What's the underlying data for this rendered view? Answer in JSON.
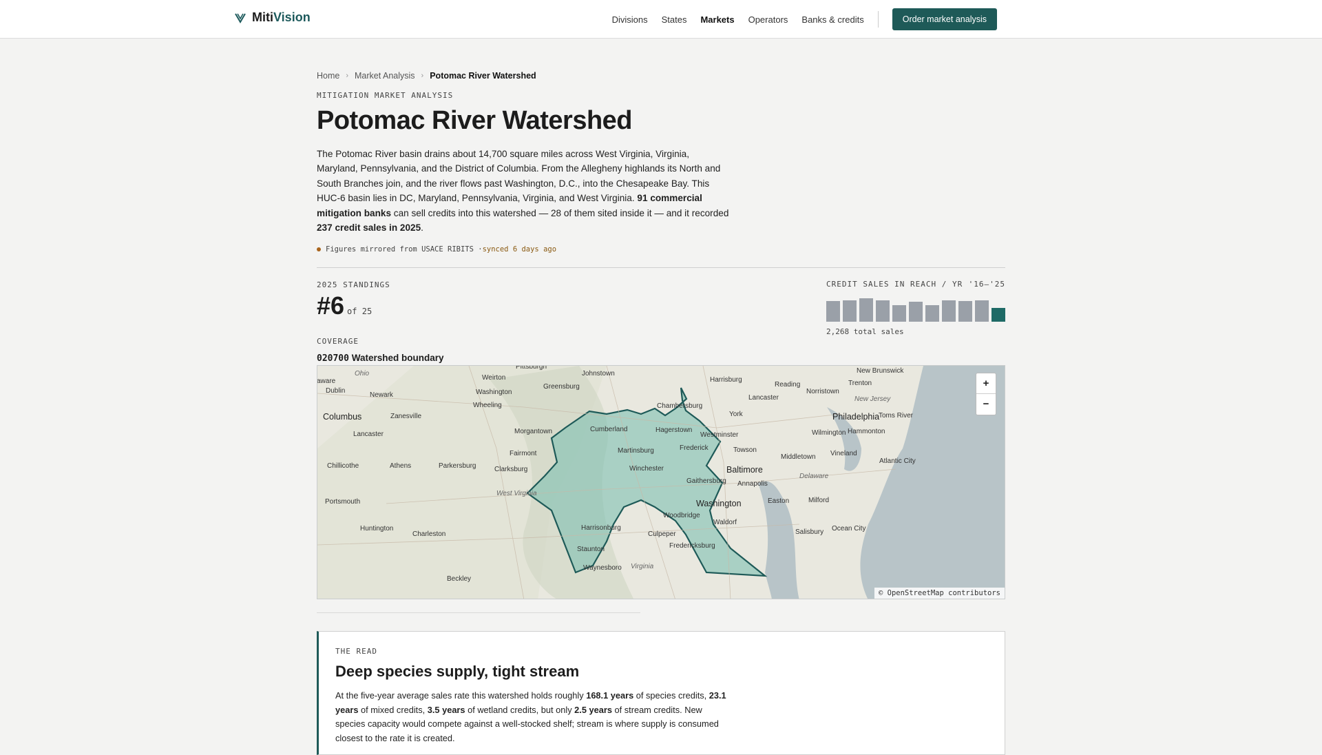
{
  "brand": {
    "name_a": "Miti",
    "name_b": "Vision"
  },
  "nav": {
    "items": [
      "Divisions",
      "States",
      "Markets",
      "Operators",
      "Banks & credits"
    ],
    "active": "Markets",
    "cta": "Order market analysis"
  },
  "breadcrumb": {
    "home": "Home",
    "section": "Market Analysis",
    "current": "Potomac River Watershed"
  },
  "header": {
    "eyebrow": "MITIGATION MARKET ANALYSIS",
    "title": "Potomac River Watershed",
    "desc_1": "The Potomac River basin drains about 14,700 square miles across West Virginia, Virginia, Maryland, Pennsylvania, and the District of Columbia. From the Allegheny highlands its North and South Branches join, and the river flows past Washington, D.C., into the Chesapeake Bay. This HUC-6 basin lies in DC, Maryland, Pennsylvania, Virginia, and West Virginia. ",
    "desc_b1": "91 commercial mitigation banks",
    "desc_2": " can sell credits into this watershed — 28 of them sited inside it — and it recorded ",
    "desc_b2": "237 credit sales in 2025",
    "desc_3": ".",
    "sync_text": "Figures mirrored from USACE RIBITS · ",
    "sync_ago": "synced 6 days ago"
  },
  "standings": {
    "label": "2025 STANDINGS",
    "rank": "#6",
    "of": "of 25"
  },
  "sparkline": {
    "label": "CREDIT SALES IN REACH / YR",
    "range": "'16–'25",
    "values": [
      0.75,
      0.78,
      0.85,
      0.78,
      0.6,
      0.72,
      0.6,
      0.78,
      0.74,
      0.78,
      0.5
    ],
    "total": "2,268 total sales"
  },
  "coverage": {
    "label": "COVERAGE",
    "code": "020700",
    "name": " Watershed boundary"
  },
  "map": {
    "zoom_in": "+",
    "zoom_out": "−",
    "attribution": "© OpenStreetMap contributors",
    "labels": {
      "pittsburgh": "Pittsburgh",
      "washington_pa": "Washington",
      "greensburg": "Greensburg",
      "johnstown": "Johnstown",
      "harrisburg": "Harrisburg",
      "reading": "Reading",
      "new_brunswick": "New Brunswick",
      "trenton": "Trenton",
      "lancaster_pa": "Lancaster",
      "norristown": "Norristown",
      "york": "York",
      "philadelphia": "Philadelphia",
      "toms_river": "Toms River",
      "new_jersey": "New Jersey",
      "chambersburg": "Chambersburg",
      "cumberland": "Cumberland",
      "hagerstown": "Hagerstown",
      "westminster": "Westminster",
      "wilmington": "Wilmington",
      "hammonton": "Hammonton",
      "frederick": "Frederick",
      "towson": "Towson",
      "middletown": "Middletown",
      "vineland": "Vineland",
      "martinsburg": "Martinsburg",
      "winchester": "Winchester",
      "baltimore": "Baltimore",
      "atlantic_city": "Atlantic City",
      "gaithersburg": "Gaithersburg",
      "annapolis": "Annapolis",
      "delaware": "Delaware",
      "washington_dc": "Washington",
      "easton": "Easton",
      "milford": "Milford",
      "woodbridge": "Woodbridge",
      "waldorf": "Waldorf",
      "salisbury": "Salisbury",
      "ocean_city": "Ocean City",
      "harrisonburg": "Harrisonburg",
      "culpeper": "Culpeper",
      "fredericksburg": "Fredericksburg",
      "staunton": "Staunton",
      "waynesboro": "Waynesboro",
      "virginia": "Virginia",
      "west_virginia": "West Virginia",
      "ohio": "Ohio",
      "delaware_oh": "aware",
      "dublin": "Dublin",
      "newark": "Newark",
      "columbus": "Columbus",
      "zanesville": "Zanesville",
      "wheeling": "Wheeling",
      "weirton": "Weirton",
      "morgantown": "Morgantown",
      "fairmont": "Fairmont",
      "lancaster_oh": "Lancaster",
      "chillicothe": "Chillicothe",
      "athens": "Athens",
      "parkersburg": "Parkersburg",
      "clarksburg": "Clarksburg",
      "portsmouth": "Portsmouth",
      "huntington": "Huntington",
      "charleston": "Charleston",
      "beckley": "Beckley"
    }
  },
  "read": {
    "eyebrow": "THE READ",
    "title": "Deep species supply, tight stream",
    "p_1": "At the five-year average sales rate this watershed holds roughly ",
    "b_1": "168.1 years",
    "p_2": " of species credits, ",
    "b_2": "23.1 years",
    "p_3": " of mixed credits, ",
    "b_3": "3.5 years",
    "p_4": " of wetland credits, but only ",
    "b_4": "2.5 years",
    "p_5": " of stream credits. New species capacity would compete against a well-stocked shelf; stream is where supply is consumed closest to the rate it is created."
  },
  "colors": {
    "accent": "#1e5a58",
    "watershed_fill": "#7fbfb2",
    "bar": "#9aa0a8",
    "bar_current": "#1e6a66"
  }
}
